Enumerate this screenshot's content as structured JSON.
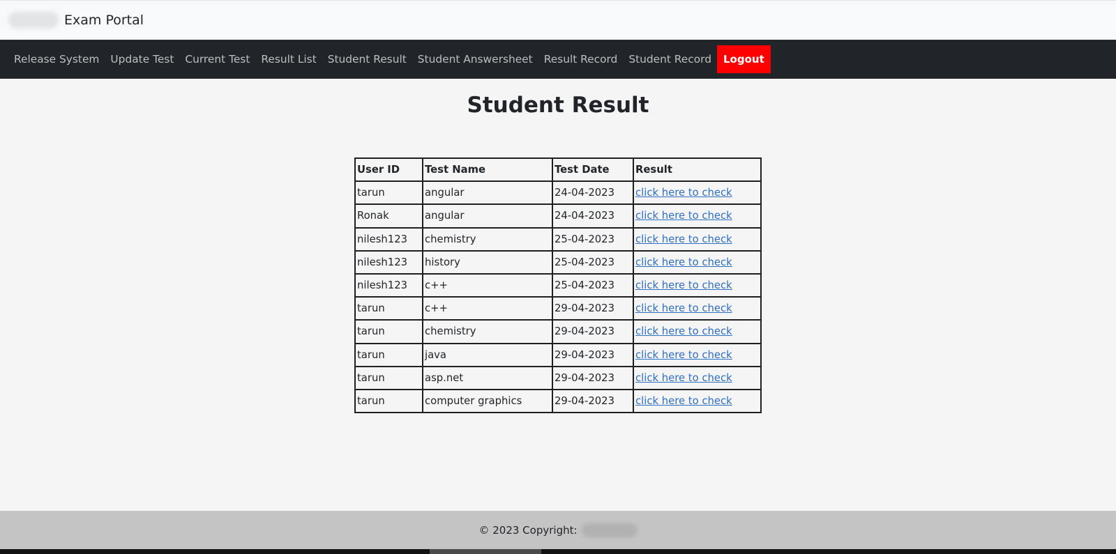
{
  "header": {
    "brand_title": "Exam Portal"
  },
  "nav": {
    "items": [
      {
        "label": "Release System"
      },
      {
        "label": "Update Test"
      },
      {
        "label": "Current Test"
      },
      {
        "label": "Result List"
      },
      {
        "label": "Student Result"
      },
      {
        "label": "Student Answersheet"
      },
      {
        "label": "Result Record"
      },
      {
        "label": "Student Record"
      }
    ],
    "logout_label": "Logout",
    "logout_color": "#ff0000"
  },
  "main": {
    "title": "Student Result",
    "table": {
      "headers": [
        "User ID",
        "Test Name",
        "Test Date",
        "Result"
      ],
      "rows": [
        {
          "user_id": "tarun",
          "test_name": "angular",
          "test_date": "24-04-2023",
          "result": "click here to check"
        },
        {
          "user_id": "Ronak",
          "test_name": "angular",
          "test_date": "24-04-2023",
          "result": "click here to check"
        },
        {
          "user_id": "nilesh123",
          "test_name": "chemistry",
          "test_date": "25-04-2023",
          "result": "click here to check"
        },
        {
          "user_id": "nilesh123",
          "test_name": "history",
          "test_date": "25-04-2023",
          "result": "click here to check"
        },
        {
          "user_id": "nilesh123",
          "test_name": "c++",
          "test_date": "25-04-2023",
          "result": "click here to check"
        },
        {
          "user_id": "tarun",
          "test_name": "c++",
          "test_date": "29-04-2023",
          "result": "click here to check"
        },
        {
          "user_id": "tarun",
          "test_name": "chemistry",
          "test_date": "29-04-2023",
          "result": "click here to check"
        },
        {
          "user_id": "tarun",
          "test_name": "java",
          "test_date": "29-04-2023",
          "result": "click here to check"
        },
        {
          "user_id": "tarun",
          "test_name": "asp.net",
          "test_date": "29-04-2023",
          "result": "click here to check"
        },
        {
          "user_id": "tarun",
          "test_name": "computer graphics",
          "test_date": "29-04-2023",
          "result": "click here to check"
        }
      ]
    }
  },
  "footer": {
    "copyright_text": "© 2023 Copyright:"
  }
}
